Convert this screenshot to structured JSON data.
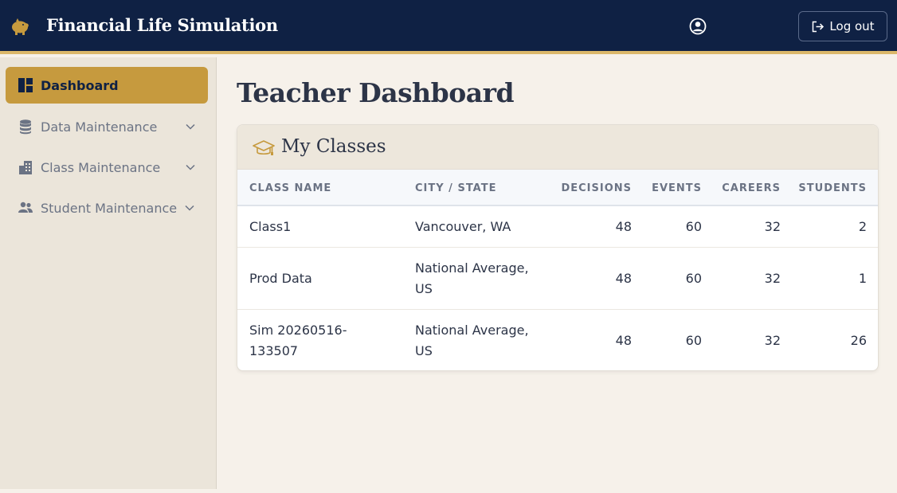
{
  "header": {
    "app_title": "Financial Life Simulation",
    "logout_label": "Log out"
  },
  "sidebar": {
    "items": [
      {
        "label": "Dashboard"
      },
      {
        "label": "Data Maintenance"
      },
      {
        "label": "Class Maintenance"
      },
      {
        "label": "Student Maintenance"
      }
    ]
  },
  "main": {
    "page_title": "Teacher Dashboard",
    "card_title": "My Classes",
    "columns": [
      "CLASS NAME",
      "CITY / STATE",
      "DECISIONS",
      "EVENTS",
      "CAREERS",
      "STUDENTS"
    ],
    "rows": [
      {
        "name_l1": "Class1",
        "name_l2": "",
        "city_l1": "Vancouver, WA",
        "city_l2": "",
        "decisions": "48",
        "events": "60",
        "careers": "32",
        "students": "2"
      },
      {
        "name_l1": "Prod Data",
        "name_l2": "",
        "city_l1": "National Average,",
        "city_l2": "US",
        "decisions": "48",
        "events": "60",
        "careers": "32",
        "students": "1"
      },
      {
        "name_l1": "Sim 20260516-",
        "name_l2": "133507",
        "city_l1": "National Average,",
        "city_l2": "US",
        "decisions": "48",
        "events": "60",
        "careers": "32",
        "students": "26"
      }
    ]
  },
  "colors": {
    "navy": "#0f2144",
    "gold": "#c69a3e",
    "background": "#f6f1ea"
  },
  "icons": {
    "logo": "piggy-bank-icon",
    "user": "user-circle-icon",
    "logout": "logout-icon",
    "dashboard": "dashboard-icon",
    "data": "database-icon",
    "class": "building-icon",
    "student": "users-icon",
    "card": "graduation-cap-icon"
  }
}
